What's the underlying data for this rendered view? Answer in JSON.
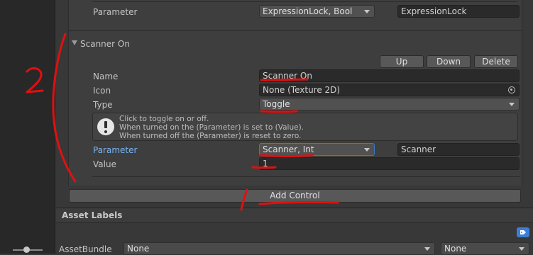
{
  "prev_control": {
    "parameter_label": "Parameter",
    "parameter_dropdown": "ExpressionLock, Bool",
    "parameter_name": "ExpressionLock"
  },
  "control": {
    "title": "Scanner On",
    "buttons": {
      "up": "Up",
      "down": "Down",
      "delete": "Delete"
    },
    "name_label": "Name",
    "name_value": "Scanner On",
    "icon_label": "Icon",
    "icon_value": "None (Texture 2D)",
    "type_label": "Type",
    "type_value": "Toggle",
    "help": {
      "line1": "Click to toggle on or off.",
      "line2": "When turned on the (Parameter) is set to (Value).",
      "line3": "When turned off the (Parameter) is reset to zero."
    },
    "parameter_label": "Parameter",
    "parameter_dropdown": "Scanner, Int",
    "parameter_name": "Scanner",
    "value_label": "Value",
    "value_value": "1"
  },
  "add_control_label": "Add Control",
  "asset_labels": {
    "title": "Asset Labels",
    "assetbundle_label": "AssetBundle",
    "bundle_value": "None",
    "variant_value": "None"
  },
  "annotation": {
    "numeral": "2",
    "color": "#e01010"
  },
  "colors": {
    "parameter_label": "#7ab4f5"
  }
}
